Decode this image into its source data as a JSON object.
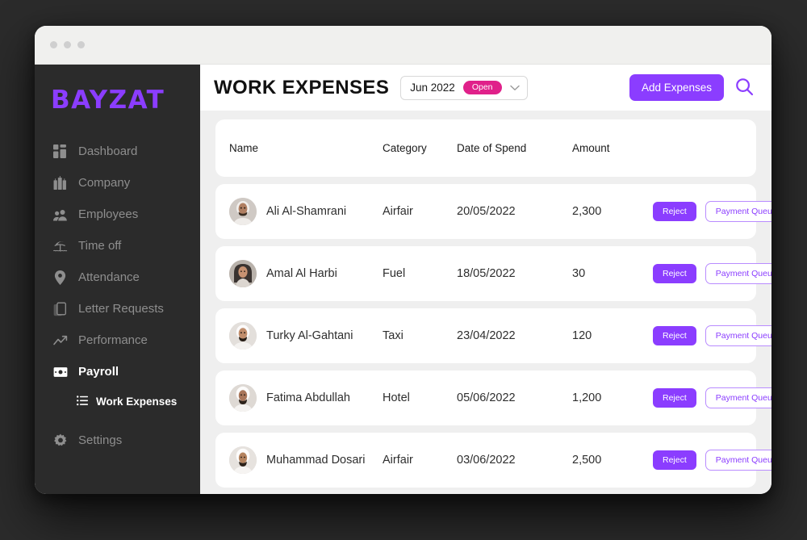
{
  "window": {
    "controls": [
      "close",
      "minimize",
      "maximize"
    ]
  },
  "sidebar": {
    "logo": "BAYZAT",
    "items": [
      {
        "label": "Dashboard",
        "icon": "dashboard-icon",
        "active": false
      },
      {
        "label": "Company",
        "icon": "building-icon",
        "active": false
      },
      {
        "label": "Employees",
        "icon": "people-icon",
        "active": false
      },
      {
        "label": "Time off",
        "icon": "beach-icon",
        "active": false
      },
      {
        "label": "Attendance",
        "icon": "location-icon",
        "active": false
      },
      {
        "label": "Letter Requests",
        "icon": "document-icon",
        "active": false
      },
      {
        "label": "Performance",
        "icon": "trending-icon",
        "active": false
      },
      {
        "label": "Payroll",
        "icon": "money-icon",
        "active": true
      }
    ],
    "sub_item": {
      "label": "Work Expenses",
      "icon": "list-icon"
    },
    "settings": {
      "label": "Settings",
      "icon": "gear-icon"
    }
  },
  "header": {
    "title": "WORK EXPENSES",
    "period": "Jun 2022",
    "status_badge": "Open",
    "add_button": "Add Expenses",
    "search_icon": "search-icon"
  },
  "table": {
    "columns": [
      "Name",
      "Category",
      "Date of Spend",
      "Amount"
    ],
    "rows": [
      {
        "name": "Ali Al-Shamrani",
        "category": "Airfair",
        "date": "20/05/2022",
        "amount": "2,300",
        "reject": "Reject",
        "queue": "Payment Queue",
        "avatar": "male-1"
      },
      {
        "name": "Amal Al Harbi",
        "category": "Fuel",
        "date": "18/05/2022",
        "amount": "30",
        "reject": "Reject",
        "queue": "Payment Queue",
        "avatar": "female-1"
      },
      {
        "name": "Turky Al-Gahtani",
        "category": "Taxi",
        "date": "23/04/2022",
        "amount": "120",
        "reject": "Reject",
        "queue": "Payment Queue",
        "avatar": "male-2"
      },
      {
        "name": "Fatima Abdullah",
        "category": "Hotel",
        "date": "05/06/2022",
        "amount": "1,200",
        "reject": "Reject",
        "queue": "Payment Queue",
        "avatar": "male-3"
      },
      {
        "name": "Muhammad Dosari",
        "category": "Airfair",
        "date": "03/06/2022",
        "amount": "2,500",
        "reject": "Reject",
        "queue": "Payment Queue",
        "avatar": "male-4"
      }
    ]
  },
  "colors": {
    "brand_purple": "#8b3dff",
    "badge_pink": "#e0218a",
    "sidebar_bg": "#2b2b2b",
    "content_bg": "#efefef",
    "page_bg": "#2b2b2b"
  }
}
